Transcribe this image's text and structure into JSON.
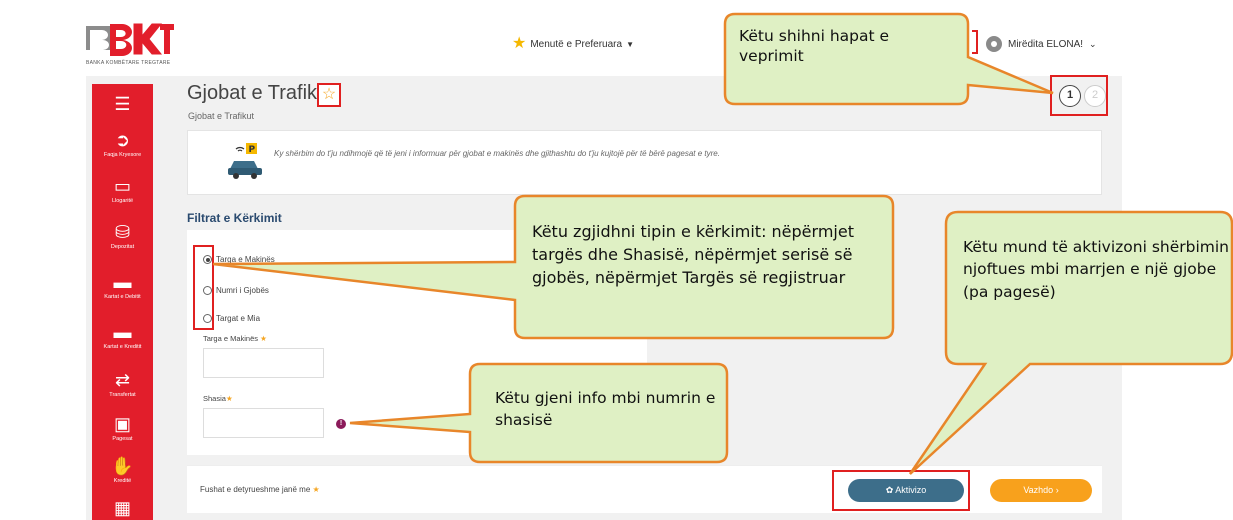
{
  "header": {
    "bank_subtitle": "BANKA KOMBËTARE TREGTARE",
    "favorites_label": "Menutë e Preferuara",
    "user_greeting": "Mirëdita ELONA!"
  },
  "sidebar": {
    "items": [
      {
        "label": "",
        "icon": "hamburger-menu-icon"
      },
      {
        "label": "Faqja Kryesore",
        "icon": "home-icon"
      },
      {
        "label": "Llogaritë",
        "icon": "accounts-icon"
      },
      {
        "label": "Depozitat",
        "icon": "deposit-icon"
      },
      {
        "label": "Kartat e Debitit",
        "icon": "debit-card-icon"
      },
      {
        "label": "Kartat e Kreditit",
        "icon": "credit-card-icon"
      },
      {
        "label": "Transfertat",
        "icon": "transfer-icon"
      },
      {
        "label": "Pagesat",
        "icon": "payments-icon"
      },
      {
        "label": "Kreditë",
        "icon": "loan-icon"
      }
    ]
  },
  "page": {
    "title": "Gjobat e Trafikut",
    "breadcrumb": "Gjobat e Trafikut",
    "steps": [
      "1",
      "2"
    ],
    "info_text": "Ky shërbim do t'ju ndihmojë që të jeni i informuar për gjobat e makinës dhe gjithashtu do t'ju kujtojë për të bërë pagesat e tyre."
  },
  "filters": {
    "title": "Filtrat e Kërkimit",
    "options": [
      "Targa e Makinës",
      "Numri i Gjobës",
      "Targat e Mia"
    ],
    "selected": "Targa e Makinës",
    "plate_label": "Targa e Makinës",
    "chassis_label": "Shasia",
    "plate_value": "",
    "chassis_value": ""
  },
  "footer": {
    "required_note": "Fushat e detyrueshme janë me",
    "activate_button": "Aktivizo",
    "continue_button": "Vazhdo"
  },
  "callouts": {
    "steps_hint": "Këtu shihni hapat e veprimit",
    "search_type_hint": "Këtu zgjidhni tipin e kërkimit: nëpërmjet targës dhe Shasisë, nëpërmjet serisë së gjobës, nëpërmjet Targës së regjistruar",
    "activate_hint": "Këtu mund të aktivizoni shërbimin njoftues mbi marrjen e një gjobe (pa pagesë)",
    "chassis_hint": "Këtu gjeni info mbi numrin e shasisë"
  },
  "colors": {
    "brand_red": "#e21e2b",
    "callout_fill": "#dff0c4",
    "callout_border": "#e8862a",
    "activate_button": "#3d6e8a",
    "continue_button": "#f8a11c",
    "highlight_red": "#e02020"
  }
}
